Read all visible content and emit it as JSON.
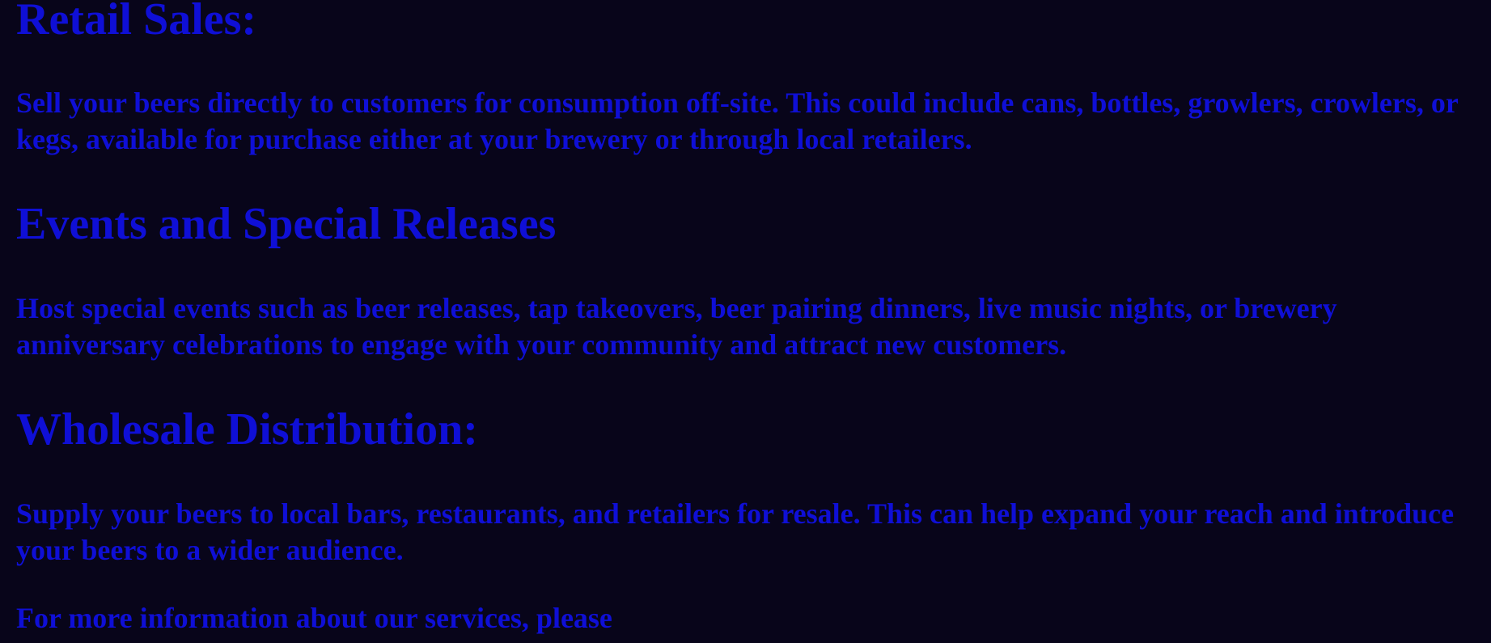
{
  "sections": [
    {
      "heading": "Retail Sales:",
      "body": "Sell your beers directly to customers for consumption off-site. This could include cans, bottles, growlers, crowlers, or kegs, available for purchase either at your brewery or through local retailers."
    },
    {
      "heading": "Events and Special Releases",
      "body": "Host special events such as beer releases, tap takeovers, beer pairing dinners, live music nights, or brewery anniversary celebrations to engage with your community and attract new customers."
    },
    {
      "heading": "Wholesale Distribution:",
      "body": "Supply your beers to local bars, restaurants, and retailers for resale. This can help expand your reach and introduce your beers to a wider audience."
    }
  ],
  "footer": {
    "text": "For more information about our services, please"
  },
  "colors": {
    "background": "#08051a",
    "text": "#0f0fd6"
  }
}
